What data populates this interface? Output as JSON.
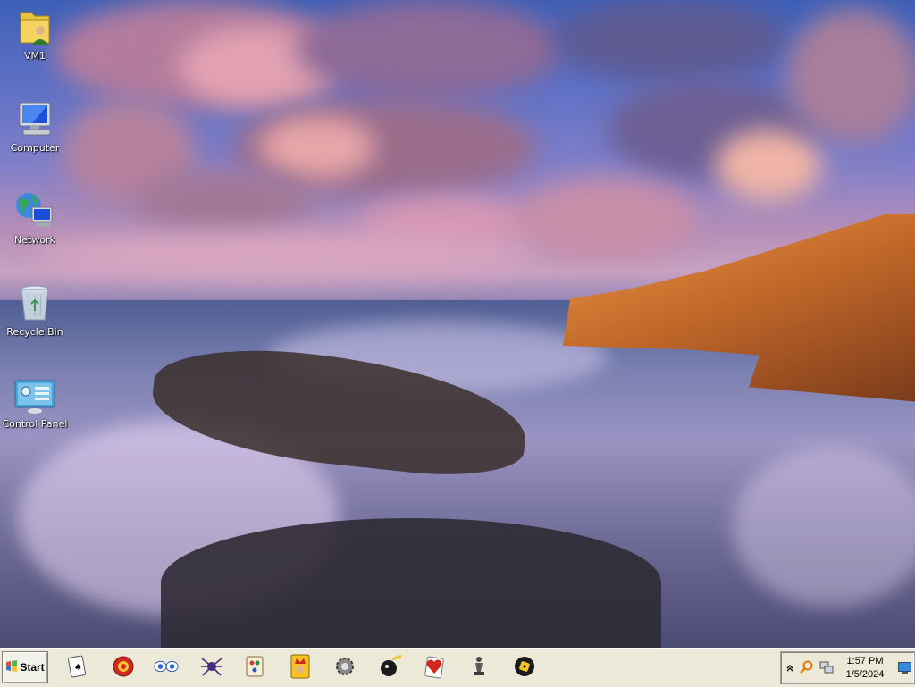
{
  "desktop": {
    "icons": [
      {
        "label": "VM1",
        "icon": "user-folder-icon"
      },
      {
        "label": "Computer",
        "icon": "computer-icon"
      },
      {
        "label": "Network",
        "icon": "network-icon"
      },
      {
        "label": "Recycle Bin",
        "icon": "recycle-bin-icon"
      },
      {
        "label": "Control Panel",
        "icon": "control-panel-icon"
      }
    ]
  },
  "taskbar": {
    "start_label": "Start",
    "pinned": [
      "solitaire-icon",
      "hearts-game-icon",
      "eyes-icon",
      "spider-solitaire-icon",
      "mahjong-icon",
      "king-card-icon",
      "gear-icon",
      "pinball-icon",
      "heart-card-icon",
      "chess-icon",
      "dice-game-icon"
    ]
  },
  "tray": {
    "icons": [
      "show-hidden-icons-chevron",
      "search-icon",
      "network-tray-icon",
      "desktop-icon"
    ],
    "time": "1:57 PM",
    "date": "1/5/2024"
  },
  "colors": {
    "taskbar_bg": "#ece9d8",
    "sky_top": "#3d5fb6",
    "cloud_pink": "#d69ab4",
    "cliff_orange": "#c46a2a"
  }
}
